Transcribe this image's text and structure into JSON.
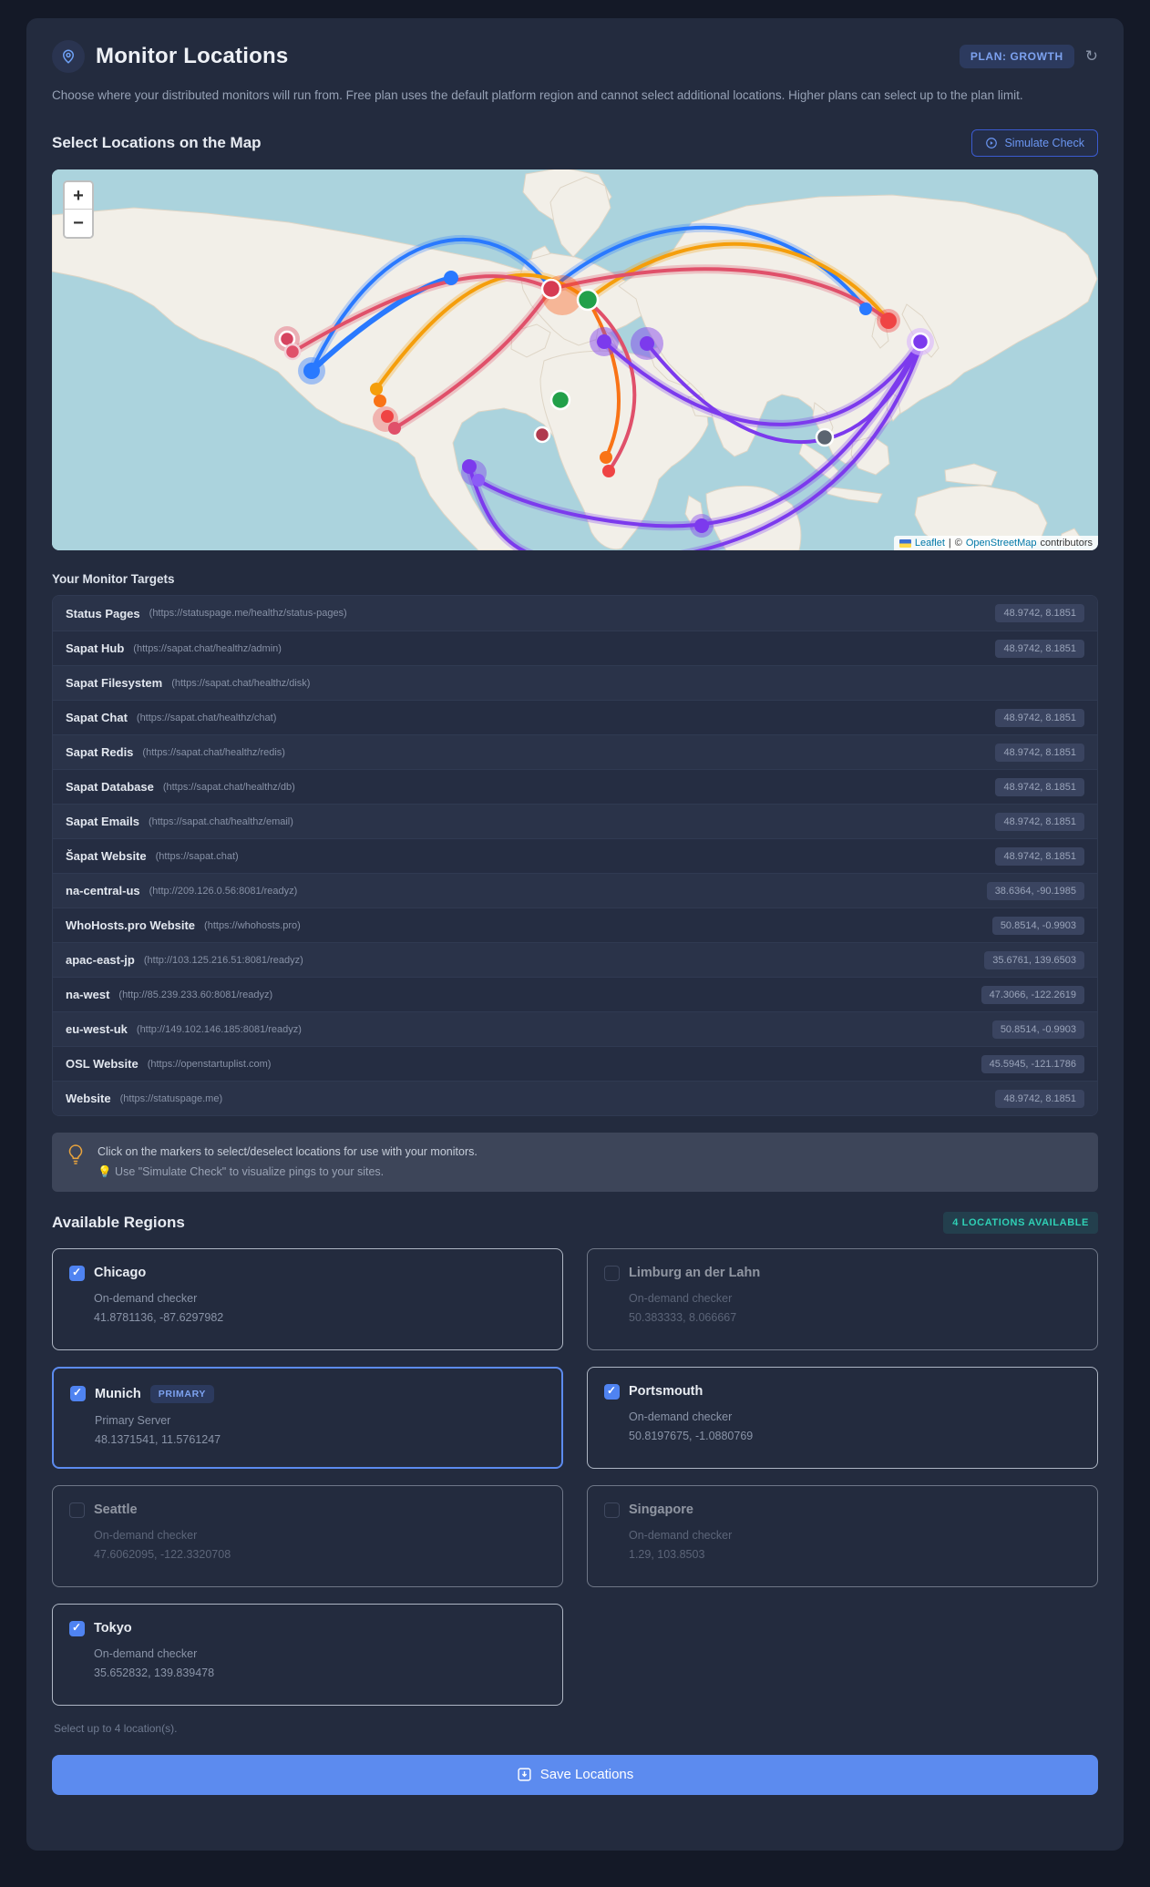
{
  "header": {
    "title": "Monitor Locations",
    "plan_badge": "PLAN: GROWTH",
    "description": "Choose where your distributed monitors will run from. Free plan uses the default platform region and cannot select additional locations. Higher plans can select up to the plan limit."
  },
  "map_section": {
    "heading": "Select Locations on the Map",
    "simulate_button": "Simulate Check",
    "zoom_in": "+",
    "zoom_out": "−",
    "attribution": {
      "leaflet": "Leaflet",
      "divider": "|",
      "copyright": "©",
      "osm": "OpenStreetMap",
      "contributors": "contributors"
    }
  },
  "targets": {
    "heading": "Your Monitor Targets",
    "rows": [
      {
        "name": "Status Pages",
        "url": "(https://statuspage.me/healthz/status-pages)",
        "coords": "48.9742, 8.1851"
      },
      {
        "name": "Sapat Hub",
        "url": "(https://sapat.chat/healthz/admin)",
        "coords": "48.9742, 8.1851"
      },
      {
        "name": "Sapat Filesystem",
        "url": "(https://sapat.chat/healthz/disk)",
        "coords": ""
      },
      {
        "name": "Sapat Chat",
        "url": "(https://sapat.chat/healthz/chat)",
        "coords": "48.9742, 8.1851"
      },
      {
        "name": "Sapat Redis",
        "url": "(https://sapat.chat/healthz/redis)",
        "coords": "48.9742, 8.1851"
      },
      {
        "name": "Sapat Database",
        "url": "(https://sapat.chat/healthz/db)",
        "coords": "48.9742, 8.1851"
      },
      {
        "name": "Sapat Emails",
        "url": "(https://sapat.chat/healthz/email)",
        "coords": "48.9742, 8.1851"
      },
      {
        "name": "Šapat Website",
        "url": "(https://sapat.chat)",
        "coords": "48.9742, 8.1851"
      },
      {
        "name": "na-central-us",
        "url": "(http://209.126.0.56:8081/readyz)",
        "coords": "38.6364, -90.1985"
      },
      {
        "name": "WhoHosts.pro Website",
        "url": "(https://whohosts.pro)",
        "coords": "50.8514, -0.9903"
      },
      {
        "name": "apac-east-jp",
        "url": "(http://103.125.216.51:8081/readyz)",
        "coords": "35.6761, 139.6503"
      },
      {
        "name": "na-west",
        "url": "(http://85.239.233.60:8081/readyz)",
        "coords": "47.3066, -122.2619"
      },
      {
        "name": "eu-west-uk",
        "url": "(http://149.102.146.185:8081/readyz)",
        "coords": "50.8514, -0.9903"
      },
      {
        "name": "OSL Website",
        "url": "(https://openstartuplist.com)",
        "coords": "45.5945, -121.1786"
      },
      {
        "name": "Website",
        "url": "(https://statuspage.me)",
        "coords": "48.9742, 8.1851"
      }
    ]
  },
  "tip": {
    "line1": "Click on the markers to select/deselect locations for use with your monitors.",
    "line2": "💡 Use \"Simulate Check\" to visualize pings to your sites."
  },
  "regions": {
    "heading": "Available Regions",
    "badge": "4 LOCATIONS AVAILABLE",
    "note": "Select up to 4 location(s).",
    "cards": [
      {
        "name": "Chicago",
        "type": "On-demand checker",
        "coords": "41.8781136, -87.6297982",
        "checked": true
      },
      {
        "name": "Limburg an der Lahn",
        "type": "On-demand checker",
        "coords": "50.383333, 8.066667",
        "checked": false
      },
      {
        "name": "Munich",
        "badge": "PRIMARY",
        "type": "Primary Server",
        "coords": "48.1371541, 11.5761247",
        "checked": true
      },
      {
        "name": "Portsmouth",
        "type": "On-demand checker",
        "coords": "50.8197675, -1.0880769",
        "checked": true
      },
      {
        "name": "Seattle",
        "type": "On-demand checker",
        "coords": "47.6062095, -122.3320708",
        "checked": false
      },
      {
        "name": "Singapore",
        "type": "On-demand checker",
        "coords": "1.29, 103.8503",
        "checked": false
      },
      {
        "name": "Tokyo",
        "type": "On-demand checker",
        "coords": "35.652832, 139.839478",
        "checked": true
      }
    ]
  },
  "save_button": "Save Locations",
  "colors": {
    "accent_blue": "#5c8bef",
    "teal_badge": "#2dd4bf",
    "panel_bg": "#232b3e",
    "page_bg": "#141927",
    "map_water": "#abd3dd",
    "map_land": "#f2efe8",
    "line_blue": "#2979ff",
    "line_orange": "#f59e0b",
    "line_red": "#e0506a",
    "line_purple": "#7c3aed"
  }
}
